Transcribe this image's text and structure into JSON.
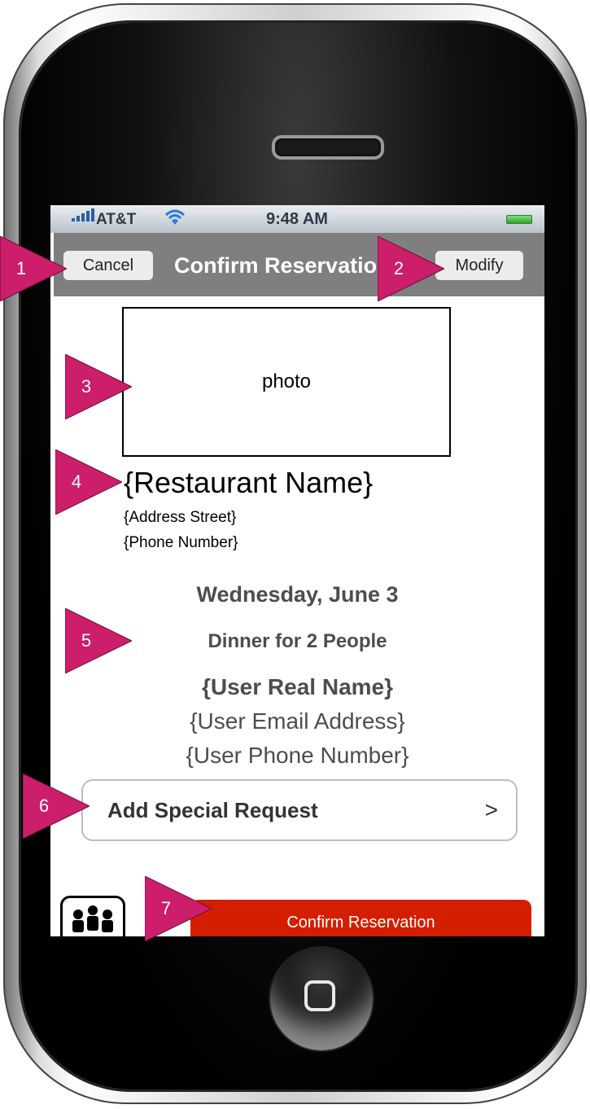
{
  "status_bar": {
    "carrier": "AT&T",
    "time": "9:48 AM"
  },
  "nav": {
    "left_button": "Cancel",
    "title": "Confirm Reservation",
    "right_button": "Modify"
  },
  "photo": {
    "label": "photo"
  },
  "restaurant": {
    "name": "{Restaurant Name}",
    "address": "{Address Street}",
    "phone": "{Phone Number}"
  },
  "reservation": {
    "date": "Wednesday, June 3",
    "party": "Dinner for 2 People",
    "user_name": "{User Real Name}",
    "user_email": "{User Email Address}",
    "user_phone": "{User Phone Number}"
  },
  "special_request": {
    "label": "Add Special Request",
    "arrow": ">"
  },
  "toolbar": {
    "group_icon": "people-group-icon",
    "confirm_label": "Confirm Reservation"
  },
  "annotations": [
    "1",
    "2",
    "3",
    "4",
    "5",
    "6",
    "7"
  ],
  "colors": {
    "marker": "#cc1e6a",
    "navbar": "#7f7f7f",
    "confirm_button": "#d41e00",
    "signal": "#2b5da8"
  }
}
